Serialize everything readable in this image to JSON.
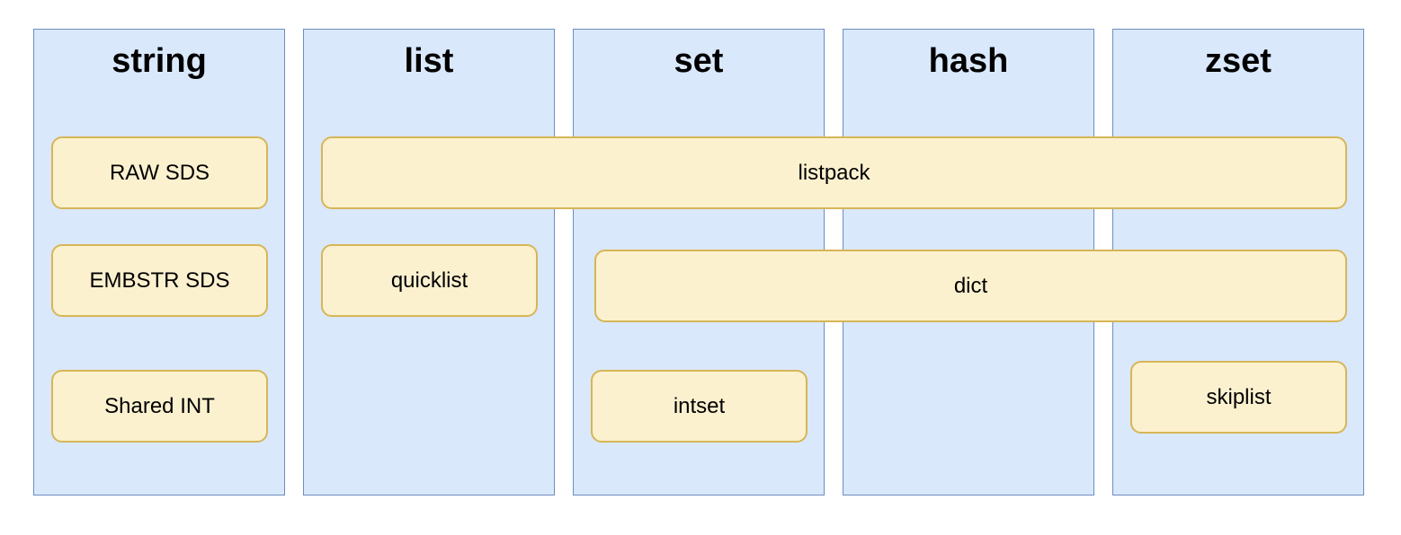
{
  "columns": [
    {
      "title": "string"
    },
    {
      "title": "list"
    },
    {
      "title": "set"
    },
    {
      "title": "hash"
    },
    {
      "title": "zset"
    }
  ],
  "encodings": {
    "raw_sds": "RAW SDS",
    "embstr_sds": "EMBSTR SDS",
    "shared_int": "Shared INT",
    "listpack": "listpack",
    "quicklist": "quicklist",
    "dict": "dict",
    "intset": "intset",
    "skiplist": "skiplist"
  },
  "colors": {
    "column_fill": "#dae8fc",
    "column_stroke": "#6c8ebf",
    "box_fill": "#fcf1cf",
    "box_stroke": "#d6b656"
  }
}
